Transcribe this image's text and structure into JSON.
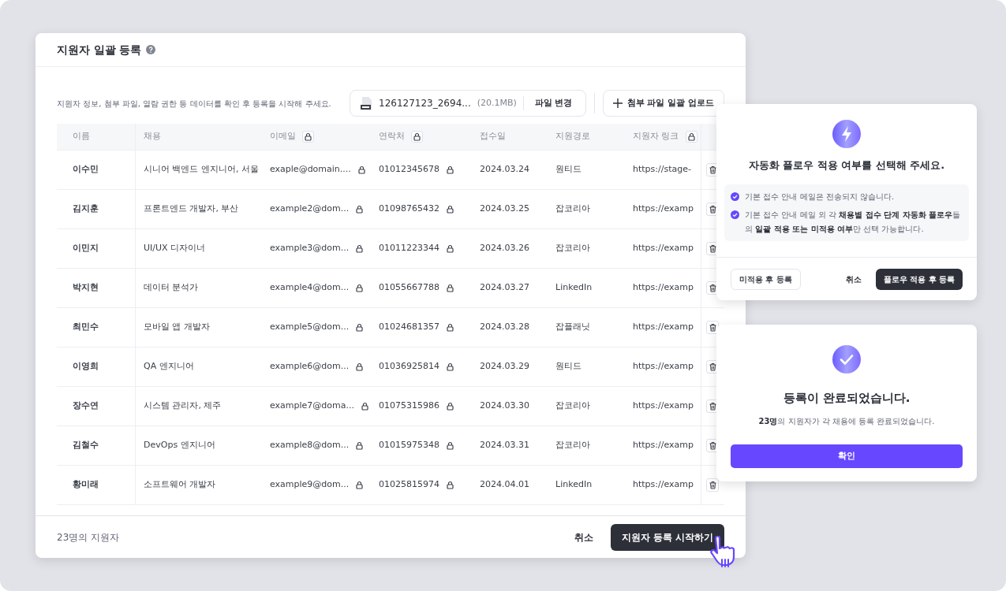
{
  "dialog": {
    "title": "지원자 일괄 등록",
    "description": "지원자 정보, 첨부 파일, 열람 권한 등 데이터를 확인 후 등록을 시작해 주세요.",
    "file": {
      "name": "126127123_2694...",
      "size": "(20.1MB)",
      "change_button": "파일 변경"
    },
    "upload_button": "첨부 파일 일괄 업로드"
  },
  "table": {
    "columns": [
      {
        "label": "이름",
        "locked": false,
        "cell_lock": false
      },
      {
        "label": "채용",
        "locked": false,
        "cell_lock": false
      },
      {
        "label": "이메일",
        "locked": true,
        "cell_lock": true
      },
      {
        "label": "연락처",
        "locked": true,
        "cell_lock": true
      },
      {
        "label": "접수일",
        "locked": false,
        "cell_lock": false
      },
      {
        "label": "지원경로",
        "locked": false,
        "cell_lock": false
      },
      {
        "label": "지원자 링크",
        "locked": true,
        "cell_lock": false
      }
    ],
    "rows": [
      {
        "cells": [
          "이수민",
          "시니어 백엔드 엔지니어, 서울",
          "exaple@domain....",
          "01012345678",
          "2024.03.24",
          "원티드",
          "https://stage-"
        ]
      },
      {
        "cells": [
          "김지훈",
          "프론트엔드 개발자, 부산",
          "example2@dom...",
          "01098765432",
          "2024.03.25",
          "잡코리아",
          "https://examp"
        ]
      },
      {
        "cells": [
          "이민지",
          "UI/UX 디자이너",
          "example3@dom...",
          "01011223344",
          "2024.03.26",
          "잡코리아",
          "https://examp"
        ]
      },
      {
        "cells": [
          "박지현",
          "데이터 분석가",
          "example4@dom...",
          "01055667788",
          "2024.03.27",
          "LinkedIn",
          "https://examp"
        ]
      },
      {
        "cells": [
          "최민수",
          "모바일 앱 개발자",
          "example5@dom...",
          "01024681357",
          "2024.03.28",
          "잡플래닛",
          "https://examp"
        ]
      },
      {
        "cells": [
          "이영희",
          "QA 엔지니어",
          "example6@dom...",
          "01036925814",
          "2024.03.29",
          "원티드",
          "https://examp"
        ]
      },
      {
        "cells": [
          "장수연",
          "시스템 관리자, 제주",
          "example7@doma...",
          "01075315986",
          "2024.03.30",
          "잡코리아",
          "https://examp"
        ]
      },
      {
        "cells": [
          "김철수",
          "DevOps 엔지니어",
          "example8@dom...",
          "01015975348",
          "2024.03.31",
          "잡코리아",
          "https://examp"
        ]
      },
      {
        "cells": [
          "황미래",
          "소프트웨어 개발자",
          "example9@dom...",
          "01025815974",
          "2024.04.01",
          "LinkedIn",
          "https://examp"
        ]
      }
    ]
  },
  "footer": {
    "count": "23명의 지원자",
    "cancel": "취소",
    "start": "지원자 등록 시작하기"
  },
  "flow_modal": {
    "title": "자동화 플로우 적용 여부를 선택해 주세요.",
    "notes": [
      "기본 접수 안내 메일은 전송되지 않습니다.",
      "기본 접수 안내 메일 외 각 **채용별 접수 단계 자동화 플로우**들의 **일괄 적용 또는 미적용 여부**만 선택 가능합니다."
    ],
    "skip_button": "미적용 후 등록",
    "cancel": "취소",
    "apply_button": "플로우 적용 후 등록"
  },
  "done_modal": {
    "title": "등록이 완료되었습니다.",
    "message": "**23명**의 지원자가 각 채용에 등록 완료되었습니다.",
    "confirm": "확인"
  }
}
